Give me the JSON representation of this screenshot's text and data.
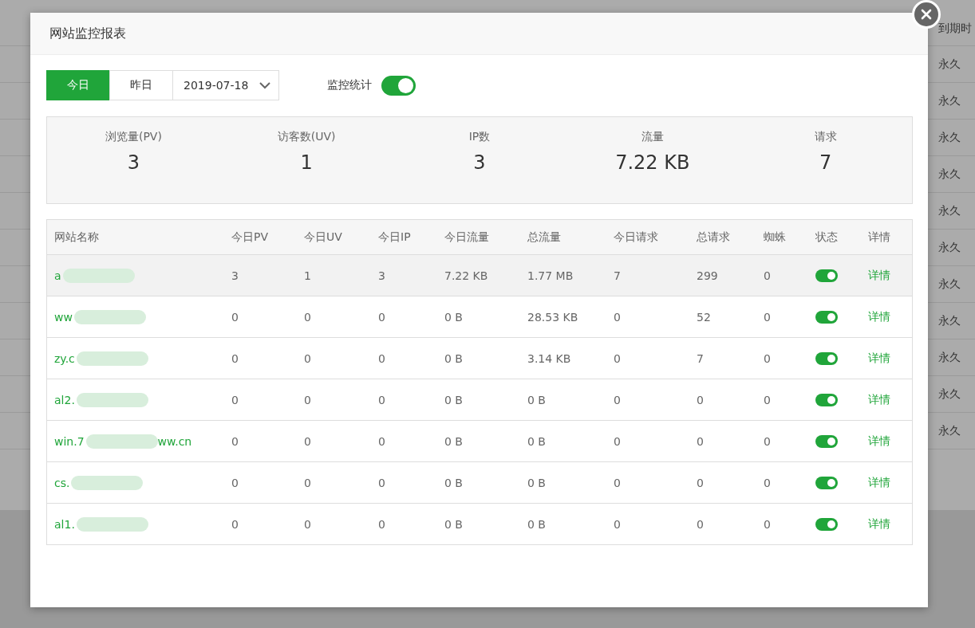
{
  "background": {
    "column_header": "到期时",
    "rows": [
      "永久",
      "永久",
      "永久",
      "永久",
      "永久",
      "永久",
      "永久",
      "永久",
      "永久",
      "永久",
      "永久"
    ]
  },
  "dialog": {
    "title": "网站监控报表",
    "day_tabs": [
      {
        "label": "今日",
        "selected": true
      },
      {
        "label": "昨日",
        "selected": false
      }
    ],
    "date_select": {
      "value": "2019-07-18"
    },
    "monitor_toggle": {
      "label": "监控统计",
      "on": true
    },
    "stats": [
      {
        "label": "浏览量(PV)",
        "value": "3"
      },
      {
        "label": "访客数(UV)",
        "value": "1"
      },
      {
        "label": "IP数",
        "value": "3"
      },
      {
        "label": "流量",
        "value": "7.22 KB"
      },
      {
        "label": "请求",
        "value": "7"
      }
    ],
    "table": {
      "columns": [
        "网站名称",
        "今日PV",
        "今日UV",
        "今日IP",
        "今日流量",
        "总流量",
        "今日请求",
        "总请求",
        "蜘蛛",
        "状态",
        "详情"
      ],
      "rows": [
        {
          "site": "a",
          "site_tail": "",
          "today_pv": "3",
          "today_uv": "1",
          "today_ip": "3",
          "today_traffic": "7.22 KB",
          "total_traffic": "1.77 MB",
          "today_requests": "7",
          "total_requests": "299",
          "spiders": "0",
          "on": true,
          "detail": "详情",
          "selected": true
        },
        {
          "site": "ww",
          "site_tail": "",
          "today_pv": "0",
          "today_uv": "0",
          "today_ip": "0",
          "today_traffic": "0 B",
          "total_traffic": "28.53 KB",
          "today_requests": "0",
          "total_requests": "52",
          "spiders": "0",
          "on": true,
          "detail": "详情",
          "selected": false
        },
        {
          "site": "zy.c",
          "site_tail": "",
          "today_pv": "0",
          "today_uv": "0",
          "today_ip": "0",
          "today_traffic": "0 B",
          "total_traffic": "3.14 KB",
          "today_requests": "0",
          "total_requests": "7",
          "spiders": "0",
          "on": true,
          "detail": "详情",
          "selected": false
        },
        {
          "site": "al2.",
          "site_tail": "",
          "today_pv": "0",
          "today_uv": "0",
          "today_ip": "0",
          "today_traffic": "0 B",
          "total_traffic": "0 B",
          "today_requests": "0",
          "total_requests": "0",
          "spiders": "0",
          "on": true,
          "detail": "详情",
          "selected": false
        },
        {
          "site": "win.7",
          "site_tail": "ww.cn",
          "today_pv": "0",
          "today_uv": "0",
          "today_ip": "0",
          "today_traffic": "0 B",
          "total_traffic": "0 B",
          "today_requests": "0",
          "total_requests": "0",
          "spiders": "0",
          "on": true,
          "detail": "详情",
          "selected": false
        },
        {
          "site": "cs.",
          "site_tail": "",
          "today_pv": "0",
          "today_uv": "0",
          "today_ip": "0",
          "today_traffic": "0 B",
          "total_traffic": "0 B",
          "today_requests": "0",
          "total_requests": "0",
          "spiders": "0",
          "on": true,
          "detail": "详情",
          "selected": false
        },
        {
          "site": "al1.",
          "site_tail": "",
          "today_pv": "0",
          "today_uv": "0",
          "today_ip": "0",
          "today_traffic": "0 B",
          "total_traffic": "0 B",
          "today_requests": "0",
          "total_requests": "0",
          "spiders": "0",
          "on": true,
          "detail": "详情",
          "selected": false
        }
      ]
    }
  }
}
